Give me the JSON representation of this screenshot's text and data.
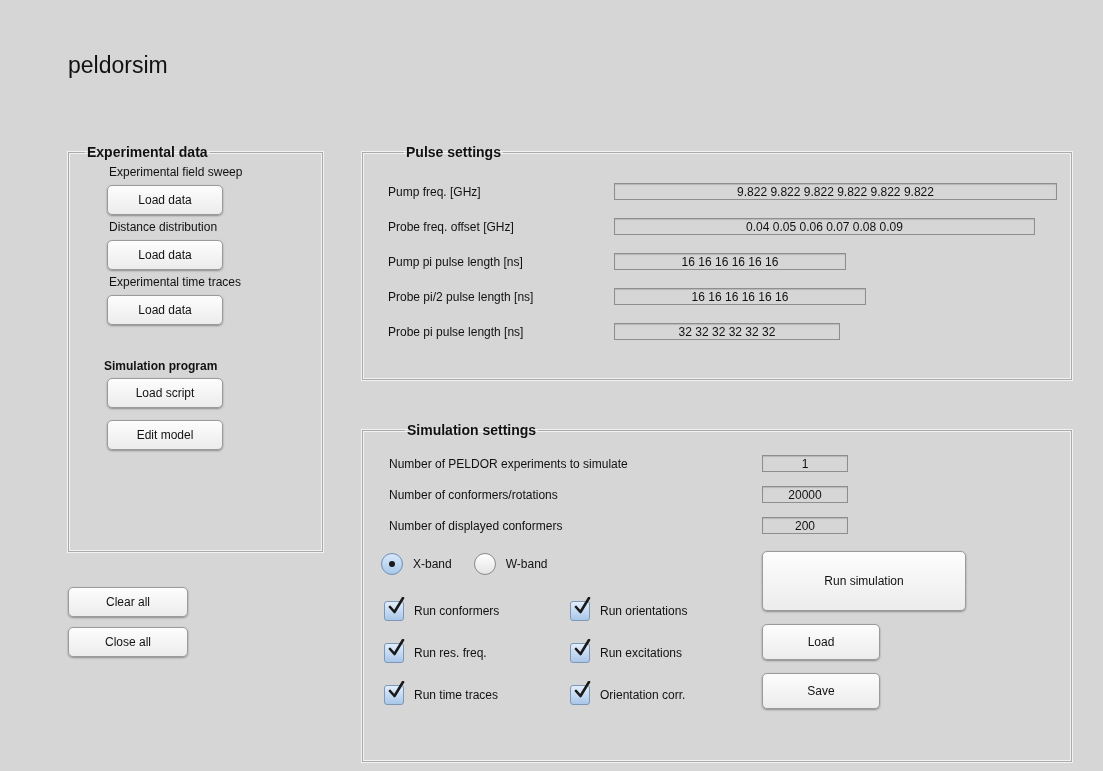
{
  "app_title": "peldorsim",
  "experimental_data": {
    "title": "Experimental data",
    "items": [
      {
        "label": "Experimental field sweep",
        "button": "Load data"
      },
      {
        "label": "Distance distribution",
        "button": "Load data"
      },
      {
        "label": "Experimental time traces",
        "button": "Load data"
      }
    ],
    "program": {
      "title": "Simulation program",
      "buttons": [
        "Load script",
        "Edit model"
      ]
    }
  },
  "global_buttons": [
    "Clear all",
    "Close all"
  ],
  "pulse_settings": {
    "title": "Pulse settings",
    "fields": [
      {
        "label": "Pump freq. [GHz]",
        "value": "9.822 9.822 9.822 9.822 9.822 9.822"
      },
      {
        "label": "Probe freq. offset [GHz]",
        "value": "0.04 0.05 0.06 0.07 0.08 0.09"
      },
      {
        "label": "Pump pi pulse length [ns]",
        "value": "16 16 16 16 16 16"
      },
      {
        "label": "Probe pi/2 pulse length [ns]",
        "value": "16 16 16 16 16 16"
      },
      {
        "label": "Probe pi pulse length [ns]",
        "value": "32 32 32 32 32 32"
      }
    ]
  },
  "simulation_settings": {
    "title": "Simulation settings",
    "fields": [
      {
        "label": "Number of PELDOR experiments to simulate",
        "value": "1"
      },
      {
        "label": "Number of conformers/rotations",
        "value": "20000"
      },
      {
        "label": "Number of displayed conformers",
        "value": "200"
      }
    ],
    "radios": [
      {
        "label": "X-band",
        "selected": true
      },
      {
        "label": "W-band",
        "selected": false
      }
    ],
    "checkboxes": [
      {
        "label": "Run conformers",
        "checked": true
      },
      {
        "label": "Run orientations",
        "checked": true
      },
      {
        "label": "Run res. freq.",
        "checked": true
      },
      {
        "label": "Run excitations",
        "checked": true
      },
      {
        "label": "Run time traces",
        "checked": true
      },
      {
        "label": "Orientation corr.",
        "checked": true
      }
    ],
    "buttons": [
      "Run simulation",
      "Load",
      "Save"
    ]
  }
}
